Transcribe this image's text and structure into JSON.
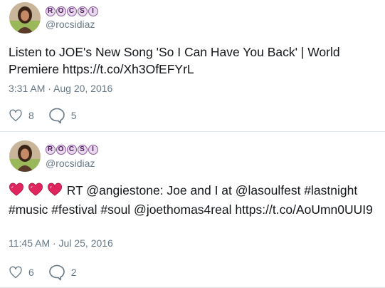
{
  "tweets": [
    {
      "name_letters": [
        "R",
        "O",
        "C",
        "S",
        "I"
      ],
      "handle": "@rocsidiaz",
      "text": "Listen to JOE's New Song 'So I Can Have You Back' | World Premiere https://t.co/Xh3OfEFYrL",
      "timestamp": "3:31 AM · Aug 20, 2016",
      "likes": "8",
      "replies": "5"
    },
    {
      "name_letters": [
        "R",
        "O",
        "C",
        "S",
        "I"
      ],
      "handle": "@rocsidiaz",
      "emoji": [
        "heart-icon",
        "heart-icon",
        "heart-icon"
      ],
      "text": "RT @angiestone: Joe and I at @lasoulfest #lastnight #music #festival #soul @joethomas4real https://t.co/AoUmn0UUI9",
      "timestamp": "11:45 AM · Jul 25, 2016",
      "likes": "6",
      "replies": "2"
    }
  ],
  "colors": {
    "text": "#14171a",
    "secondary": "#657786",
    "divider": "#e1e8ed",
    "heart_emoji": "#e0245e"
  }
}
